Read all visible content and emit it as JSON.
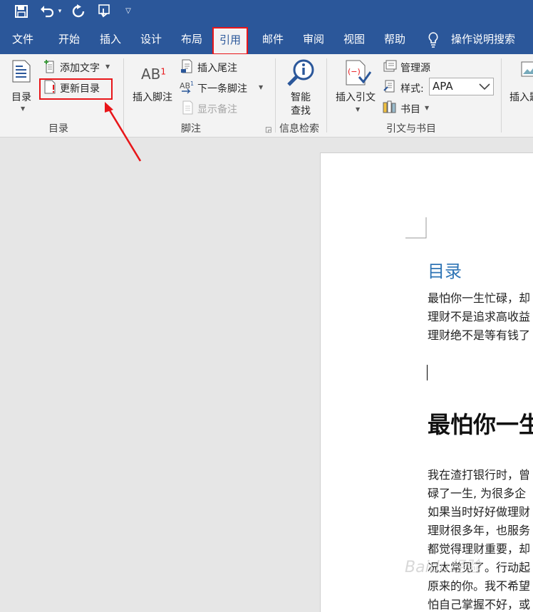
{
  "quick_access": {
    "save_icon": "save-icon",
    "undo_icon": "undo-icon",
    "redo_icon": "redo-icon",
    "touch_icon": "touch-mode-icon",
    "customize_icon": "customize-qat-icon"
  },
  "tabs": [
    "文件",
    "开始",
    "插入",
    "设计",
    "布局",
    "引用",
    "邮件",
    "审阅",
    "视图",
    "帮助"
  ],
  "active_tab": "引用",
  "tell_me": "操作说明搜索",
  "ribbon": {
    "toc_group": {
      "toc_button": "目录",
      "add_text": "添加文字",
      "update_toc": "更新目录",
      "label": "目录"
    },
    "footnote_group": {
      "insert_footnote": "插入脚注",
      "ab_glyph": "AB",
      "superscript": "1",
      "insert_endnote": "插入尾注",
      "next_footnote": "下一条脚注",
      "show_notes": "显示备注",
      "label": "脚注"
    },
    "research_group": {
      "smart_lookup": "智能\n查找",
      "smart_lookup_l1": "智能",
      "smart_lookup_l2": "查找",
      "label": "信息检索"
    },
    "citation_group": {
      "insert_citation": "插入引文",
      "manage_sources": "管理源",
      "style_label": "样式:",
      "style_value": "APA",
      "bibliography": "书目",
      "label": "引文与书目"
    },
    "caption_group": {
      "insert_caption": "插入题"
    }
  },
  "document": {
    "toc_heading": "目录",
    "toc_lines": [
      "最怕你一生忙碌，却",
      "理财不是追求高收益",
      "理财绝不是等有钱了"
    ],
    "heading1": "最怕你一生",
    "body_lines": [
      "我在渣打银行时，曾",
      "碌了一生, 为很多企",
      "如果当时好好做理财",
      "理财很多年，也服务",
      "都觉得理财重要，却",
      "况太常见了。行动起",
      "原来的你。我不希望",
      "怕自己掌握不好，或"
    ]
  },
  "watermark": "Baidu经验",
  "colors": {
    "brand": "#2b579a",
    "highlight": "#e8161a",
    "heading_blue": "#2e74b5"
  }
}
